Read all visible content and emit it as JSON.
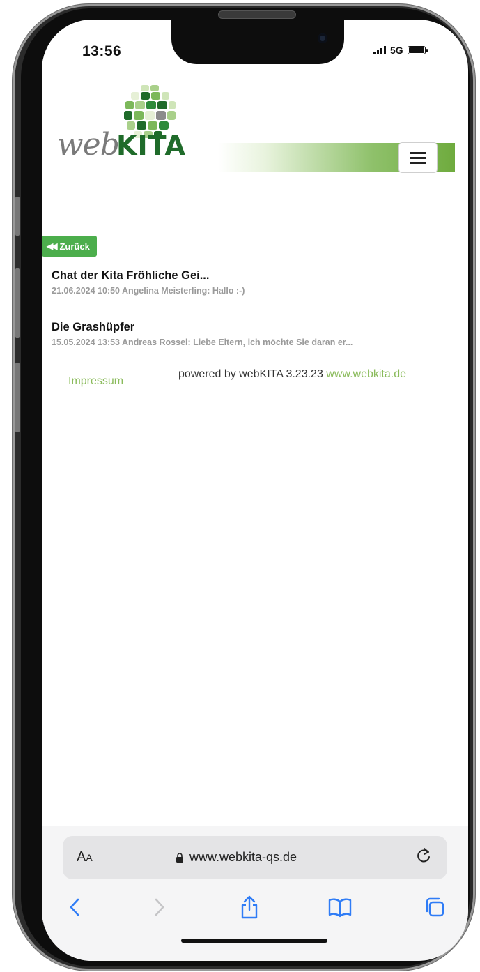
{
  "status_bar": {
    "time": "13:56",
    "network": "5G",
    "battery_level": 1.0
  },
  "header": {
    "logo_web": "web",
    "logo_kita": "KITA",
    "menu_icon": "hamburger-menu-icon"
  },
  "back_button": {
    "label": "Zurück",
    "icon": "double-chevron-left-icon"
  },
  "chats": [
    {
      "title": "Chat der Kita Fröhliche Gei...",
      "preview": "21.06.2024 10:50 Angelina Meisterling: Hallo :-)"
    },
    {
      "title": "Die Grashüpfer",
      "preview": "15.05.2024 13:53 Andreas Rossel: Liebe Eltern, ich möchte Sie daran er..."
    }
  ],
  "footer": {
    "impressum": "Impressum",
    "powered_by": "powered by webKITA 3.23.23",
    "link": "www.webkita.de"
  },
  "browser": {
    "aa_big": "A",
    "aa_small": "A",
    "url": "www.webkita-qs.de",
    "icons": [
      "back-chevron-icon",
      "forward-chevron-icon",
      "share-icon",
      "bookmarks-icon",
      "tabs-icon"
    ]
  },
  "colors": {
    "accent_green": "#8abb5b",
    "button_green": "#4cae4c",
    "logo_dark_green": "#1f6b2a"
  }
}
